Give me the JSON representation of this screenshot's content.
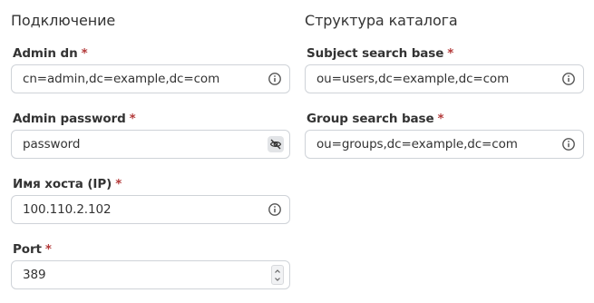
{
  "connection": {
    "title": "Подключение",
    "admin_dn": {
      "label": "Admin dn",
      "required_mark": "*",
      "value": "cn=admin,dc=example,dc=com",
      "icon": "info-icon"
    },
    "admin_password": {
      "label": "Admin password",
      "required_mark": "*",
      "value": "password",
      "icon": "eye-off-icon"
    },
    "host": {
      "label": "Имя хоста (IP)",
      "required_mark": "*",
      "value": "100.110.2.102",
      "icon": "info-icon"
    },
    "port": {
      "label": "Port",
      "required_mark": "*",
      "value": "389",
      "icon": "stepper-icon"
    }
  },
  "directory": {
    "title": "Структура каталога",
    "subject_search_base": {
      "label": "Subject search base",
      "required_mark": "*",
      "value": "ou=users,dc=example,dc=com",
      "icon": "info-icon"
    },
    "group_search_base": {
      "label": "Group search base",
      "required_mark": "*",
      "value": "ou=groups,dc=example,dc=com",
      "icon": "info-icon"
    }
  },
  "colors": {
    "required": "#b33a3a",
    "border": "#cfd3d8",
    "text": "#333333",
    "icon": "#555555"
  }
}
